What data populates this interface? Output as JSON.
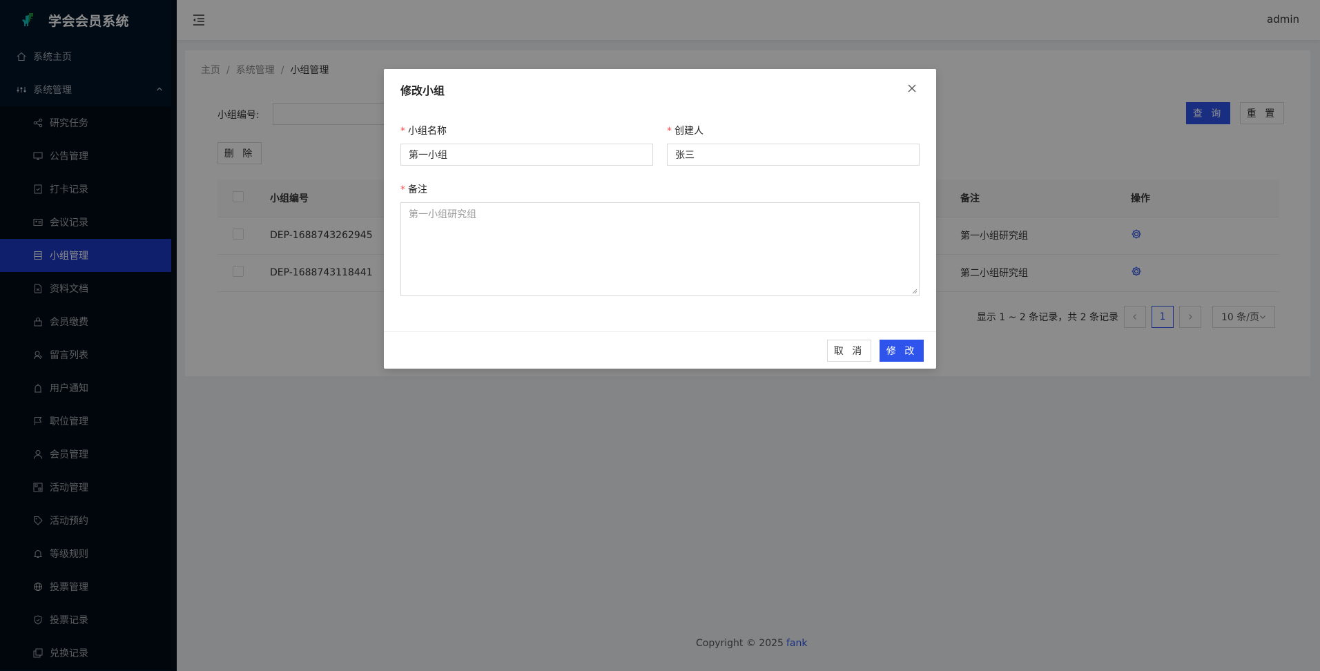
{
  "app": {
    "title": "学会会员系统",
    "user": "admin"
  },
  "sidebar": {
    "home": "系统主页",
    "group": "系统管理",
    "items": [
      {
        "label": "研究任务",
        "icon": "share-icon"
      },
      {
        "label": "公告管理",
        "icon": "monitor-icon"
      },
      {
        "label": "打卡记录",
        "icon": "checkin-icon"
      },
      {
        "label": "会议记录",
        "icon": "id-card-icon"
      },
      {
        "label": "小组管理",
        "icon": "database-icon",
        "active": true
      },
      {
        "label": "资料文档",
        "icon": "file-icon"
      },
      {
        "label": "会员缴费",
        "icon": "lock-icon"
      },
      {
        "label": "留言列表",
        "icon": "comment-icon"
      },
      {
        "label": "用户通知",
        "icon": "notification-icon"
      },
      {
        "label": "职位管理",
        "icon": "flag-icon"
      },
      {
        "label": "会员管理",
        "icon": "user-icon"
      },
      {
        "label": "活动管理",
        "icon": "qrcode-icon"
      },
      {
        "label": "活动预约",
        "icon": "tag-icon"
      },
      {
        "label": "等级规则",
        "icon": "bell-icon"
      },
      {
        "label": "投票管理",
        "icon": "global-icon"
      },
      {
        "label": "投票记录",
        "icon": "shield-icon"
      },
      {
        "label": "兑换记录",
        "icon": "copy-icon"
      }
    ]
  },
  "breadcrumb": {
    "home": "主页",
    "parent": "系统管理",
    "current": "小组管理"
  },
  "search": {
    "label": "小组编号:",
    "query_btn": "查 询",
    "reset_btn": "重 置"
  },
  "actions": {
    "delete_btn": "删 除"
  },
  "table": {
    "headers": {
      "id": "小组编号",
      "remark": "备注",
      "op": "操作"
    },
    "rows": [
      {
        "id": "DEP-1688743262945",
        "remark": "第一小组研究组"
      },
      {
        "id": "DEP-1688743118441",
        "remark": "第二小组研究组"
      }
    ]
  },
  "pagination": {
    "summary": "显示 1 ~ 2 条记录，共 2 条记录",
    "current": "1",
    "page_size": "10 条/页"
  },
  "footer": {
    "copyright": "Copyright © 2025",
    "author": "fank"
  },
  "modal": {
    "title": "修改小组",
    "name_label": "小组名称",
    "name_value": "第一小组",
    "creator_label": "创建人",
    "creator_value": "张三",
    "remark_label": "备注",
    "remark_placeholder": "第一小组研究组",
    "cancel_btn": "取 消",
    "submit_btn": "修 改"
  },
  "colors": {
    "primary": "#2f54eb",
    "sidebar": "#001529",
    "required": "#ff4d4f"
  }
}
